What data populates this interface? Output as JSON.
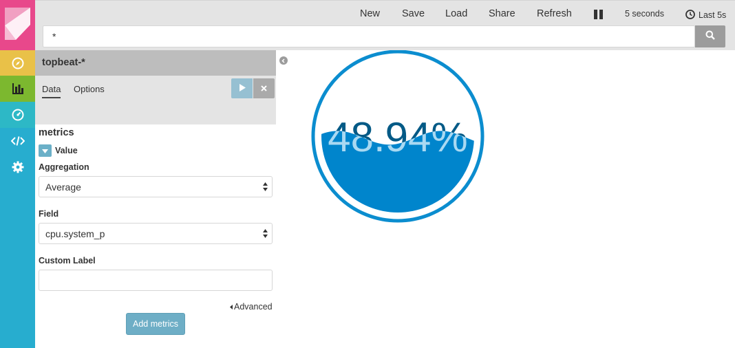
{
  "topbar": {
    "menu": {
      "new": "New",
      "save": "Save",
      "load": "Load",
      "share": "Share",
      "refresh": "Refresh",
      "interval": "5 seconds",
      "timepicker": "Last 5s"
    },
    "search": {
      "value": "*"
    }
  },
  "editor": {
    "index_pattern": "topbeat-*",
    "tabs": [
      "Data",
      "Options"
    ],
    "section_title": "metrics",
    "agg_title": "Value",
    "aggregation": {
      "label": "Aggregation",
      "value": "Average"
    },
    "field": {
      "label": "Field",
      "value": "cpu.system_p"
    },
    "custom_label": {
      "label": "Custom Label",
      "value": ""
    },
    "advanced": "Advanced",
    "add_metrics": "Add metrics"
  },
  "gauge": {
    "value_text": "48.94%",
    "fill_fraction": 0.4894,
    "colors": {
      "ring": "#0b8dcf",
      "fill": "#0085cc",
      "text_dark": "#045a86",
      "text_light": "#a9d9f2"
    }
  },
  "nav_icons": [
    "kibana-logo",
    "compass-icon",
    "bar-chart-icon",
    "dashboard-gauge-icon",
    "code-icon",
    "gear-icon"
  ],
  "colors": {
    "logo": "#e8488b",
    "discover": "#e9c148",
    "visualize": "#7cb82f",
    "dashboard": "#2db8c6",
    "nav": "#27adcf"
  }
}
